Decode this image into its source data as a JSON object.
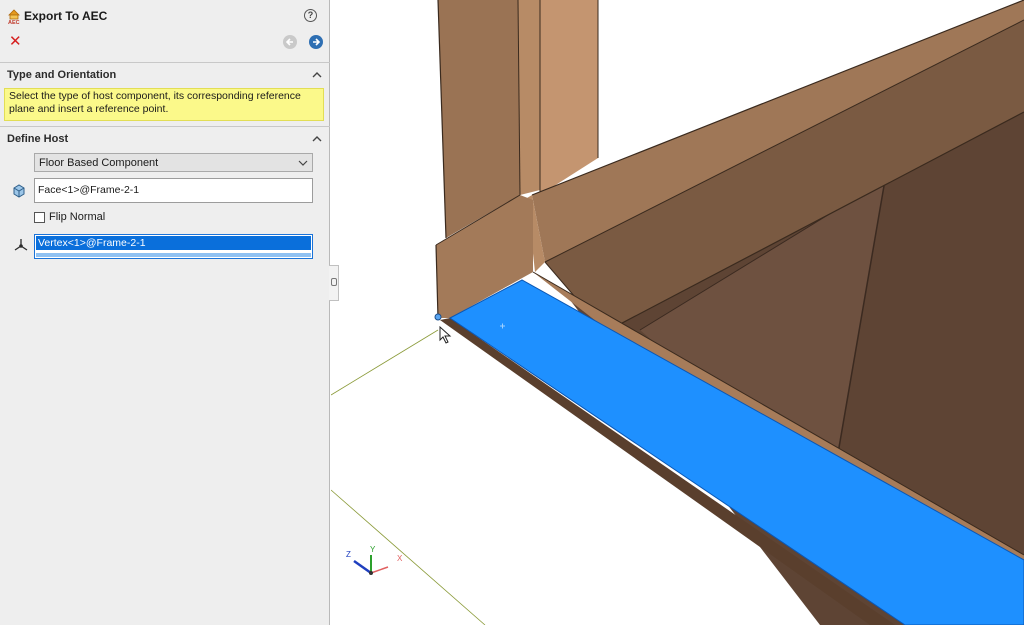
{
  "panel": {
    "title": "Export To AEC",
    "help_glyph": "?",
    "cancel_glyph": "✕",
    "sections": {
      "type_orientation": {
        "header": "Type and Orientation",
        "message": "Select the type of host component, its corresponding reference plane and insert a reference point."
      },
      "define_host": {
        "header": "Define Host",
        "host_type": "Floor Based Component",
        "face_selection": "Face<1>@Frame-2-1",
        "flip_normal_label": "Flip Normal",
        "flip_normal_checked": false,
        "vertex_selection": "Vertex<1>@Frame-2-1"
      }
    }
  },
  "triad": {
    "x": "X",
    "y": "Y",
    "z": "Z"
  },
  "colors": {
    "accent": "#0a6fdb",
    "selected_face": "#1e90ff",
    "frame": "#8f6b4f",
    "message_bg": "#fbf98a"
  },
  "icons": [
    "aec-app-icon",
    "help-icon",
    "cancel-icon",
    "back-arrow-icon",
    "next-arrow-icon",
    "chevron-up-icon",
    "dropdown-arrow-icon",
    "face-selection-icon",
    "vertex-selection-icon",
    "mouse-cursor-icon",
    "coordinate-triad-icon"
  ]
}
